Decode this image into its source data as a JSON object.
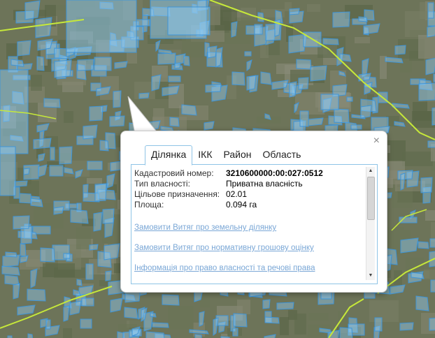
{
  "colors": {
    "parcel_fill": "#8ec9f2",
    "parcel_stroke": "#3f95d8",
    "boundary_line": "#c6e83a",
    "tab_border": "#8fc4e6",
    "link": "#7aa7d6"
  },
  "popup": {
    "close_icon": "×",
    "tabs": [
      {
        "label": "Ділянка",
        "active": true
      },
      {
        "label": "ІКК",
        "active": false
      },
      {
        "label": "Район",
        "active": false
      },
      {
        "label": "Область",
        "active": false
      }
    ],
    "fields": [
      {
        "label": "Кадастровий номер:",
        "value": "3210600000:00:027:0512"
      },
      {
        "label": "Тип власності:",
        "value": "Приватна власність"
      },
      {
        "label": "Цільове призначення:",
        "value": "02.01"
      },
      {
        "label": "Площа:",
        "value": "0.094 га"
      }
    ],
    "links": [
      "Замовити Витяг про земельну ділянку",
      "Замовити Витяг про нормативну грошову оцінку",
      "Інформація про право власності та речові права"
    ],
    "scroll_up_icon": "▲",
    "scroll_down_icon": "▼"
  }
}
